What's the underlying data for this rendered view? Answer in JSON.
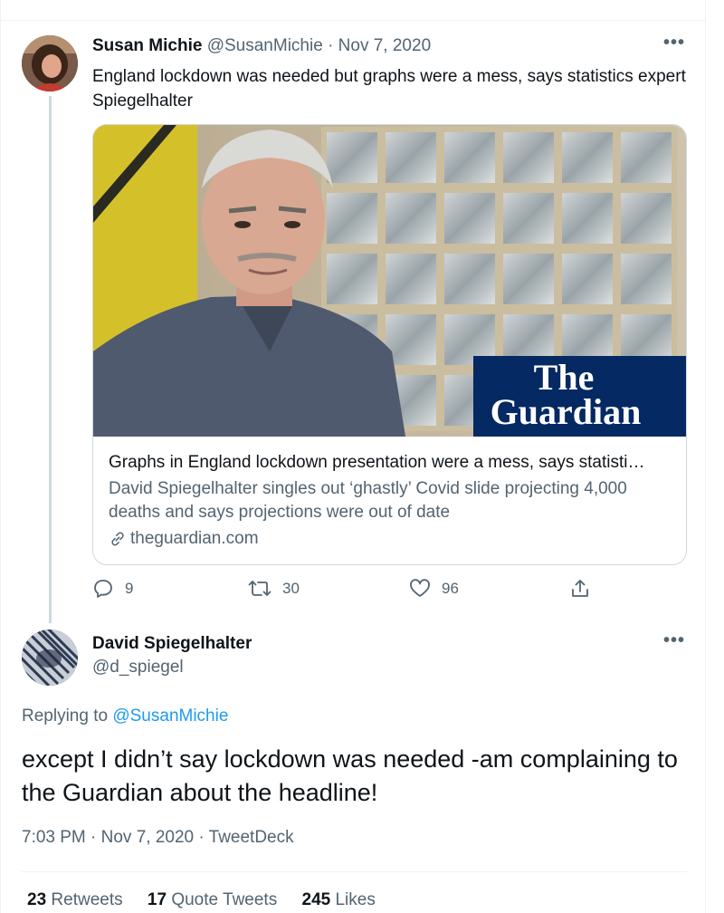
{
  "tweet1": {
    "author_name": "Susan Michie",
    "author_handle": "@SusanMichie",
    "separator": "·",
    "date": "Nov 7, 2020",
    "more_label": "•••",
    "text": "England lockdown was needed but graphs were a mess, says statistics expert Spiegelhalter",
    "card": {
      "brand_line1": "The",
      "brand_line2": "Guardian",
      "title": "Graphs in England lockdown presentation were a mess, says statisti…",
      "description": "David Spiegelhalter singles out ‘ghastly’ Covid slide projecting 4,000 deaths and says projections were out of date",
      "domain": "theguardian.com"
    },
    "actions": {
      "replies": "9",
      "retweets": "30",
      "likes": "96"
    }
  },
  "tweet2": {
    "author_name": "David Spiegelhalter",
    "author_handle": "@d_spiegel",
    "more_label": "•••",
    "replying_prefix": "Replying to",
    "replying_to": "@SusanMichie",
    "text": "except I didn’t say lockdown was needed  -am complaining to the Guardian about the headline!",
    "timestamp": "7:03 PM · Nov 7, 2020 · TweetDeck",
    "stats": {
      "retweets_count": "23",
      "retweets_label": "Retweets",
      "quotes_count": "17",
      "quotes_label": "Quote Tweets",
      "likes_count": "245",
      "likes_label": "Likes"
    }
  },
  "colors": {
    "text_primary": "#0f1419",
    "text_muted": "#536471",
    "link": "#1d9bf0",
    "border": "#cfd9de",
    "guardian_blue": "#052962"
  }
}
